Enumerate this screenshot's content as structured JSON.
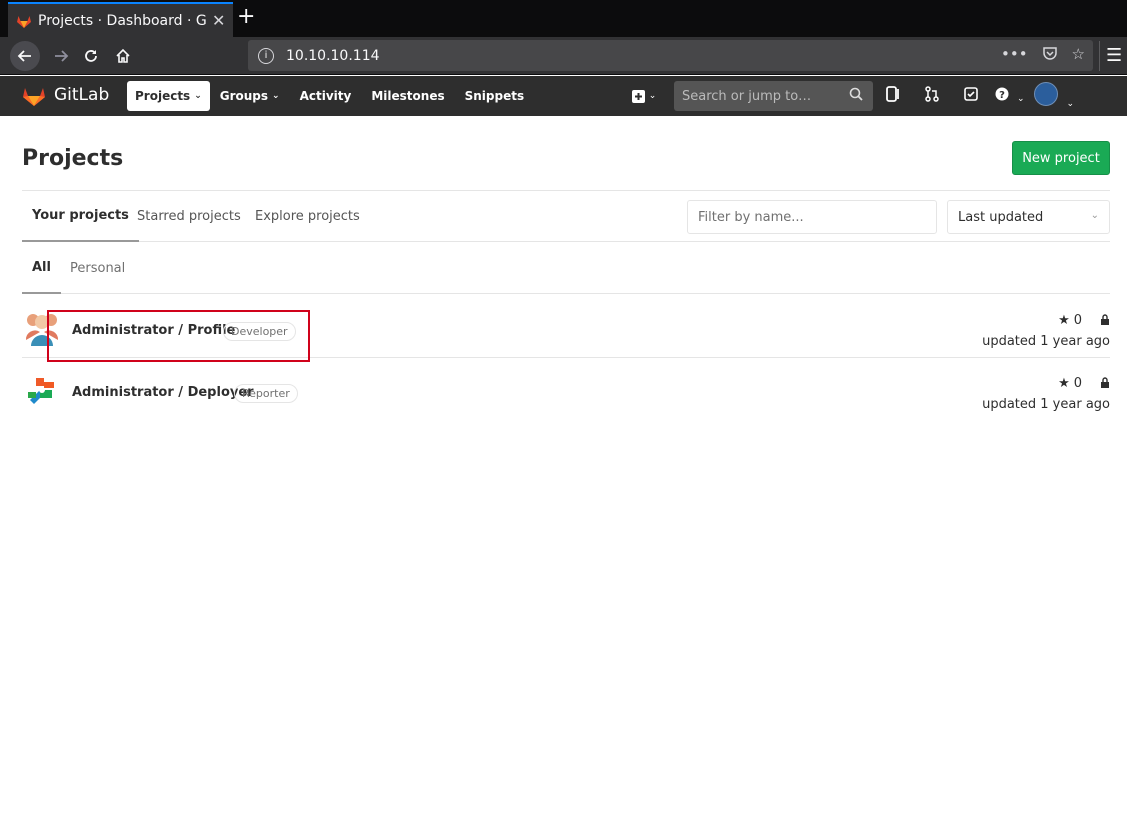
{
  "browser": {
    "tab_title": "Projects · Dashboard · GitLab",
    "close_glyph": "✕",
    "newtab_glyph": "+",
    "url": "10.10.10.114",
    "icons": [
      "back-icon",
      "forward-icon",
      "reload-icon",
      "home-icon",
      "info-icon",
      "more-icon",
      "pocket-icon",
      "bookmark-star-icon",
      "hamburger-menu-icon"
    ]
  },
  "gitlab": {
    "brand": "GitLab",
    "nav": [
      {
        "label": "Projects",
        "caret": "⌄"
      },
      {
        "label": "Groups",
        "caret": "⌄"
      },
      {
        "label": "Activity"
      },
      {
        "label": "Milestones"
      },
      {
        "label": "Snippets"
      }
    ],
    "search_placeholder": "Search or jump to…",
    "accent": "#1aaa55",
    "header_bg": "#2e2e2e"
  },
  "page": {
    "title": "Projects",
    "new_project": "New project",
    "tabs": [
      "Your projects",
      "Starred projects",
      "Explore projects"
    ],
    "filter_placeholder": "Filter by name...",
    "sort_value": "Last updated",
    "subtabs": [
      "All",
      "Personal"
    ]
  },
  "projects": [
    {
      "name": "Administrator / Profile",
      "role": "Developer",
      "stars": "0",
      "updated": "updated 1 year ago"
    },
    {
      "name": "Administrator / Deployer",
      "role": "Reporter",
      "stars": "0",
      "updated": "updated 1 year ago"
    }
  ]
}
